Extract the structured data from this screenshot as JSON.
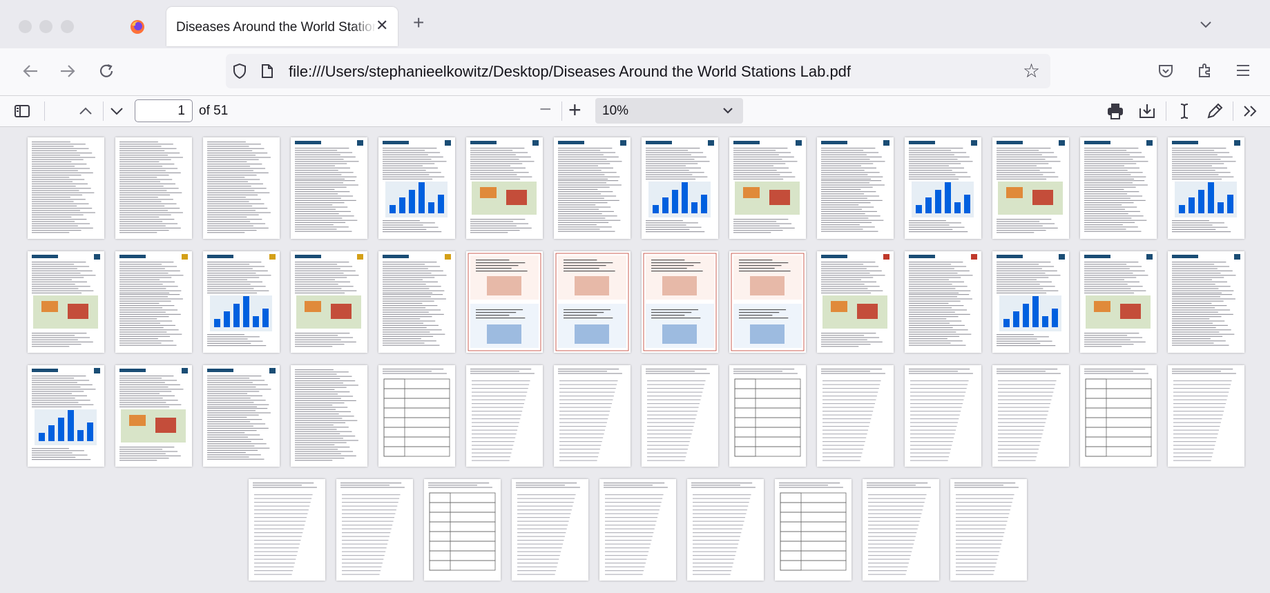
{
  "browser": {
    "tab_title": "Diseases Around the World Stations",
    "url": "file:///Users/stephanieelkowitz/Desktop/Diseases Around the World Stations Lab.pdf"
  },
  "pdf_toolbar": {
    "page_number": "1",
    "page_count_label": "of 51",
    "zoom_level": "10%"
  },
  "icons": {
    "firefox": "firefox-logo-icon",
    "tab_close": "close-icon",
    "new_tab": "plus-icon",
    "tab_list": "chevron-down-icon",
    "back": "arrow-left-icon",
    "forward": "arrow-right-icon",
    "reload": "reload-icon",
    "tracking": "shield-icon",
    "page_info": "document-icon",
    "bookmark": "star-icon",
    "pocket": "pocket-icon",
    "extensions": "puzzle-icon",
    "menu": "hamburger-menu-icon",
    "sidebar": "sidebar-toggle-icon",
    "prev_page": "chevron-up-icon",
    "next_page": "chevron-down-icon",
    "zoom_out": "minus-icon",
    "zoom_in": "plus-icon",
    "print": "printer-icon",
    "save": "download-icon",
    "text_tool": "text-cursor-icon",
    "draw_tool": "pen-icon",
    "more_tools": "double-chevron-right-icon"
  },
  "colors": {
    "accent": "#0060df",
    "station_badge": "#1a4d75",
    "research_badge": "#c0392b",
    "analysis_badge": "#d4a017",
    "infographic_border": "#c0392b"
  }
}
